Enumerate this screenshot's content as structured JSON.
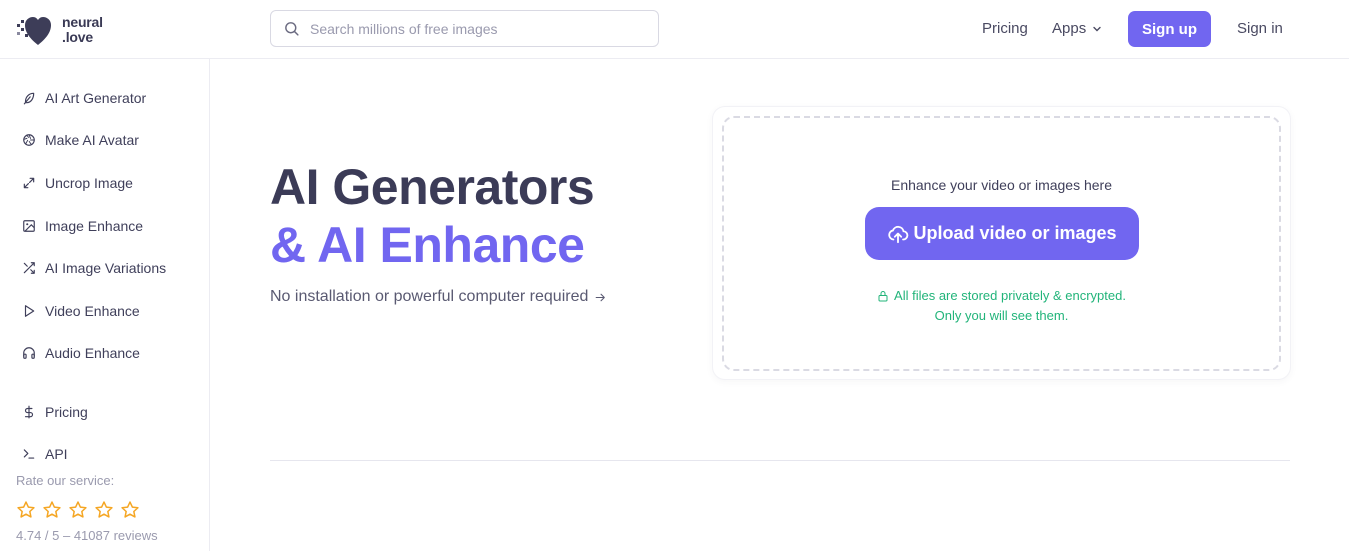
{
  "header": {
    "logo_line1": "neural",
    "logo_line2": ".love",
    "search_placeholder": "Search millions of free images",
    "nav_pricing": "Pricing",
    "nav_apps": "Apps",
    "signup": "Sign up",
    "signin": "Sign in"
  },
  "sidebar": {
    "items": [
      {
        "label": "AI Art Generator",
        "icon": "feather-icon"
      },
      {
        "label": "Make AI Avatar",
        "icon": "aperture-icon"
      },
      {
        "label": "Uncrop Image",
        "icon": "expand-icon"
      },
      {
        "label": "Image Enhance",
        "icon": "image-icon"
      },
      {
        "label": "AI Image Variations",
        "icon": "shuffle-icon"
      },
      {
        "label": "Video Enhance",
        "icon": "play-icon"
      },
      {
        "label": "Audio Enhance",
        "icon": "headphones-icon"
      },
      {
        "label": "Pricing",
        "icon": "dollar-icon"
      },
      {
        "label": "API",
        "icon": "terminal-icon"
      }
    ],
    "rate_label": "Rate our service:",
    "rating_text": "4.74 / 5 – 41087 reviews",
    "star_color": "#f5a623"
  },
  "hero": {
    "title_line1": "AI Generators",
    "title_line2": "& AI Enhance",
    "subtitle": "No installation or powerful computer required"
  },
  "upload": {
    "title": "Enhance your video or images here",
    "button": "Upload video or images",
    "secure_line1": "All files are stored privately & encrypted.",
    "secure_line2": "Only you will see them."
  },
  "colors": {
    "accent": "#7166f0",
    "secure": "#22b47a"
  }
}
